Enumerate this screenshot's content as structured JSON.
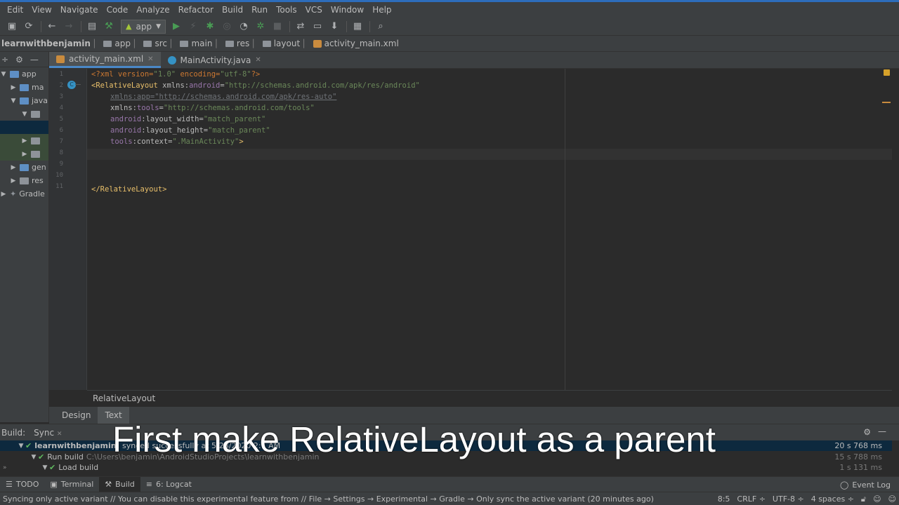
{
  "menu": [
    "Edit",
    "View",
    "Navigate",
    "Code",
    "Analyze",
    "Refactor",
    "Build",
    "Run",
    "Tools",
    "VCS",
    "Window",
    "Help"
  ],
  "toolbar": {
    "run_config": "app"
  },
  "breadcrumb": [
    "learnwithbenjamin",
    "app",
    "src",
    "main",
    "res",
    "layout",
    "activity_main.xml"
  ],
  "project_tree": {
    "items": [
      "app",
      "ma",
      "java",
      "",
      "",
      "",
      "",
      "gen",
      "res",
      "Gradle"
    ]
  },
  "tabs": [
    {
      "label": "activity_main.xml",
      "active": true
    },
    {
      "label": "MainActivity.java",
      "active": false
    }
  ],
  "editor": {
    "line_numbers": [
      "1",
      "2",
      "3",
      "4",
      "5",
      "6",
      "7",
      "8",
      "9",
      "10",
      "11"
    ],
    "lines": {
      "l1_a": "<?xml version=",
      "l1_b": "\"1.0\"",
      "l1_c": " encoding=",
      "l1_d": "\"utf-8\"",
      "l1_e": "?>",
      "l2_a": "<RelativeLayout ",
      "l2_b": "xmlns:",
      "l2_c": "android",
      "l2_d": "=",
      "l2_e": "\"http://schemas.android.com/apk/res/android\"",
      "l3": "xmlns:app=\"http://schemas.android.com/apk/res-auto\"",
      "l4_a": "xmlns:",
      "l4_b": "tools",
      "l4_c": "=",
      "l4_d": "\"http://schemas.android.com/tools\"",
      "l5_a": "android",
      "l5_b": ":layout_width=",
      "l5_c": "\"match_parent\"",
      "l6_a": "android",
      "l6_b": ":layout_height=",
      "l6_c": "\"match_parent\"",
      "l7_a": "tools",
      "l7_b": ":context=",
      "l7_c": "\".MainActivity\"",
      "l7_d": ">",
      "l11": "</RelativeLayout>"
    },
    "bottom_breadcrumb": "RelativeLayout"
  },
  "design_tabs": [
    {
      "label": "Design",
      "active": false
    },
    {
      "label": "Text",
      "active": true
    }
  ],
  "build_panel": {
    "title": "Build:",
    "tab": "Sync",
    "rows": [
      {
        "label": "learnwithbenjamin:",
        "detail": "synced successfully at 5/28/2020 2:1 AM",
        "time": "20 s 768 ms"
      },
      {
        "label": "Run build",
        "detail": "C:\\Users\\benjamin\\AndroidStudioProjects\\learnwithbenjamin",
        "time": "15 s 788 ms"
      },
      {
        "label": "Load build",
        "detail": "",
        "time": "1 s 131 ms"
      }
    ]
  },
  "caption": "First make RelativeLayout as a parent",
  "tool_windows": [
    {
      "label": "TODO",
      "icon": "list-icon"
    },
    {
      "label": "Terminal",
      "icon": "terminal-icon"
    },
    {
      "label": "Build",
      "icon": "hammer-icon",
      "active": true
    },
    {
      "label": "6: Logcat",
      "icon": "logcat-icon"
    }
  ],
  "event_log": "Event Log",
  "status": {
    "message": "Syncing only active variant // You can disable this experimental feature from // File → Settings → Experimental → Gradle → Only sync the active variant (20 minutes ago)",
    "position": "8:5",
    "line_sep": "CRLF ÷",
    "encoding": "UTF-8 ÷",
    "indent": "4 spaces ÷"
  },
  "colors": {
    "accent": "#4a88c7",
    "success": "#5fb85f",
    "warning": "#d6a12a"
  }
}
